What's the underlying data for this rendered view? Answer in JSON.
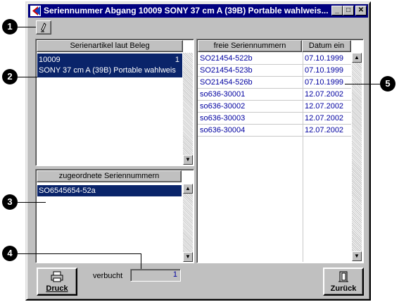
{
  "window": {
    "title": "Seriennummer Abgang 10009 SONY 37 cm A (39B) Portable wahlweis...",
    "min_label": "_",
    "max_label": "□",
    "close_label": "✕"
  },
  "articles_panel": {
    "header": "Serienartikel laut Beleg",
    "rows": [
      {
        "number": "10009",
        "qty": "1",
        "name": "SONY 37 cm A (39B) Portable wahlweis"
      }
    ]
  },
  "assigned_panel": {
    "header": "zugeordnete Seriennummern",
    "items": [
      "SO6545654-52a"
    ]
  },
  "free_panel": {
    "col_serial": "freie Seriennummern",
    "col_date": "Datum ein",
    "rows": [
      {
        "serial": "SO21454-522b",
        "date": "07.10.1999"
      },
      {
        "serial": "SO21454-523b",
        "date": "07.10.1999"
      },
      {
        "serial": "SO21454-526b",
        "date": "07.10.1999"
      },
      {
        "serial": "so636-30001",
        "date": "12.07.2002"
      },
      {
        "serial": "so636-30002",
        "date": "12.07.2002"
      },
      {
        "serial": "so636-30003",
        "date": "12.07.2002"
      },
      {
        "serial": "so636-30004",
        "date": "12.07.2002"
      }
    ]
  },
  "footer": {
    "booked_label": "verbucht",
    "booked_value": "1",
    "print_label": "Druck",
    "back_label": "Zurück"
  },
  "callouts": [
    "1",
    "2",
    "3",
    "4",
    "5"
  ],
  "colors": {
    "selection": "#0a246a",
    "title_bar": "#000080",
    "value_text": "#0000a0"
  }
}
